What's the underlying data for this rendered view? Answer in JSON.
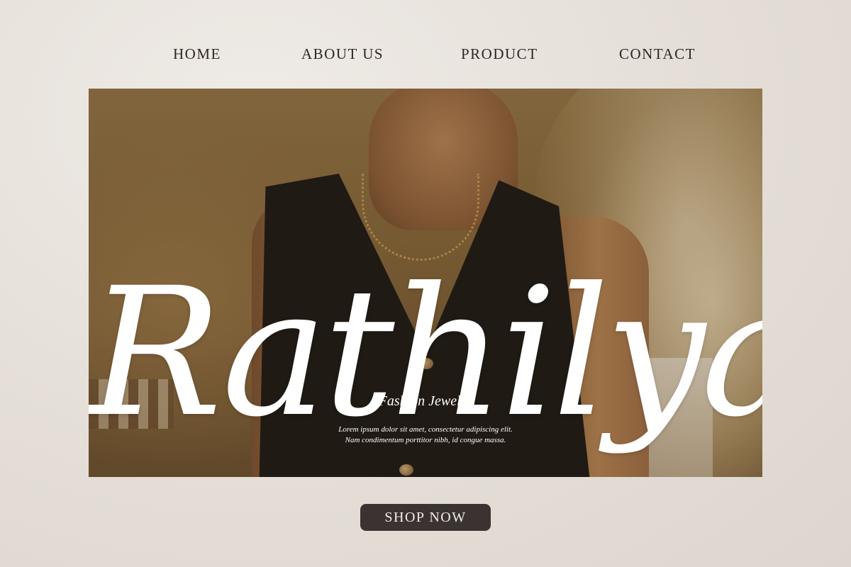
{
  "nav": {
    "items": [
      {
        "label": "HOME"
      },
      {
        "label": "ABOUT US"
      },
      {
        "label": "PRODUCT"
      },
      {
        "label": "CONTACT"
      }
    ]
  },
  "hero": {
    "brand": "Rathilya",
    "tagline": "Fashion Jewelry",
    "description_lines": [
      "Lorem ipsum dolor sit amet, consectetur adipiscing elit.",
      "Nam condimentum porttitor nibh, id congue massa."
    ]
  },
  "cta": {
    "label": "SHOP NOW"
  },
  "colors": {
    "background": "#e4ded7",
    "nav_text": "#2d2724",
    "button_bg": "#3b3331",
    "button_text": "#f2ece6",
    "hero_text": "#ffffff"
  }
}
